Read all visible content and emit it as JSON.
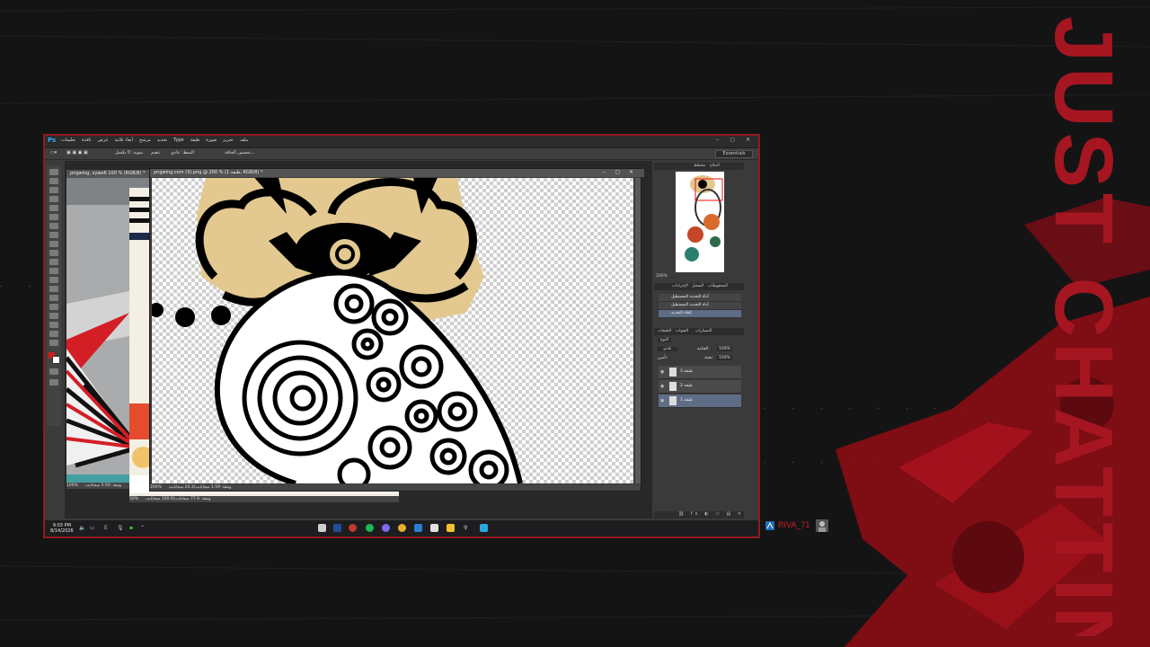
{
  "colors": {
    "accent": "#8f1b22",
    "brand_red": "#c41f2b",
    "ps_blue": "#31a8ff",
    "selection": "#5e6d85"
  },
  "overlay": {
    "brand_text": "JUST CHATTIN",
    "username": "RIVA_71"
  },
  "photoshop": {
    "app_logo": "Ps",
    "menus": [
      "ملف",
      "تحرير",
      "صورة",
      "طبقة",
      "Type",
      "تحديد",
      "مرشح",
      "أبعاد ثلاثية",
      "عرض",
      "نافذة",
      "تعليمات"
    ],
    "workspace": "Essentials",
    "options": {
      "feather": "تمويه: 0 بكسل",
      "antialias": "تنعيم",
      "style": "النمط: عادي",
      "refine": "تحسين الحافة..."
    },
    "documents": {
      "main_title": "pngwing.com (3).png @ 200 % (طبقة 1, RGB/8) *",
      "main_zoom": "200%",
      "main_status": "وثيقة: 1.59 ميجابايت/24.3 ميجابايت",
      "back_title": "pngwing, xywe6 100 % (RGB/8) *",
      "back_zoom": "100%",
      "back_status": "وثيقة: 5.93 ميجابايت",
      "mid_zoom": "50%",
      "mid_status": "وثيقة: 77.9 ميجابايت/100.0 ميجابايت"
    },
    "panels": {
      "navigator_tabs": [
        "مخطط",
        "الملاح"
      ],
      "navigator_zoom": "200%",
      "history_tabs": [
        "الإجراءات",
        "السجل",
        "المحفوظات"
      ],
      "history_items": [
        "أداة التحديد المستطيل",
        "أداة التحديد المستطيل",
        "إلغاء التحديد"
      ],
      "layers_tabs": [
        "الطبقات",
        "القنوات",
        "المسارات"
      ],
      "blend_mode": "عادي",
      "opacity_label": "العتامة:",
      "opacity_value": "100%",
      "lock_label": "تأمين:",
      "fill_label": "تعبئة:",
      "fill_value": "100%",
      "kind": "النوع",
      "layers": [
        "طبقة 3",
        "طبقة 2",
        "طبقة 1"
      ]
    }
  },
  "taskbar": {
    "time": "9:03 PM",
    "date": "8/14/2026",
    "lang": "E"
  }
}
